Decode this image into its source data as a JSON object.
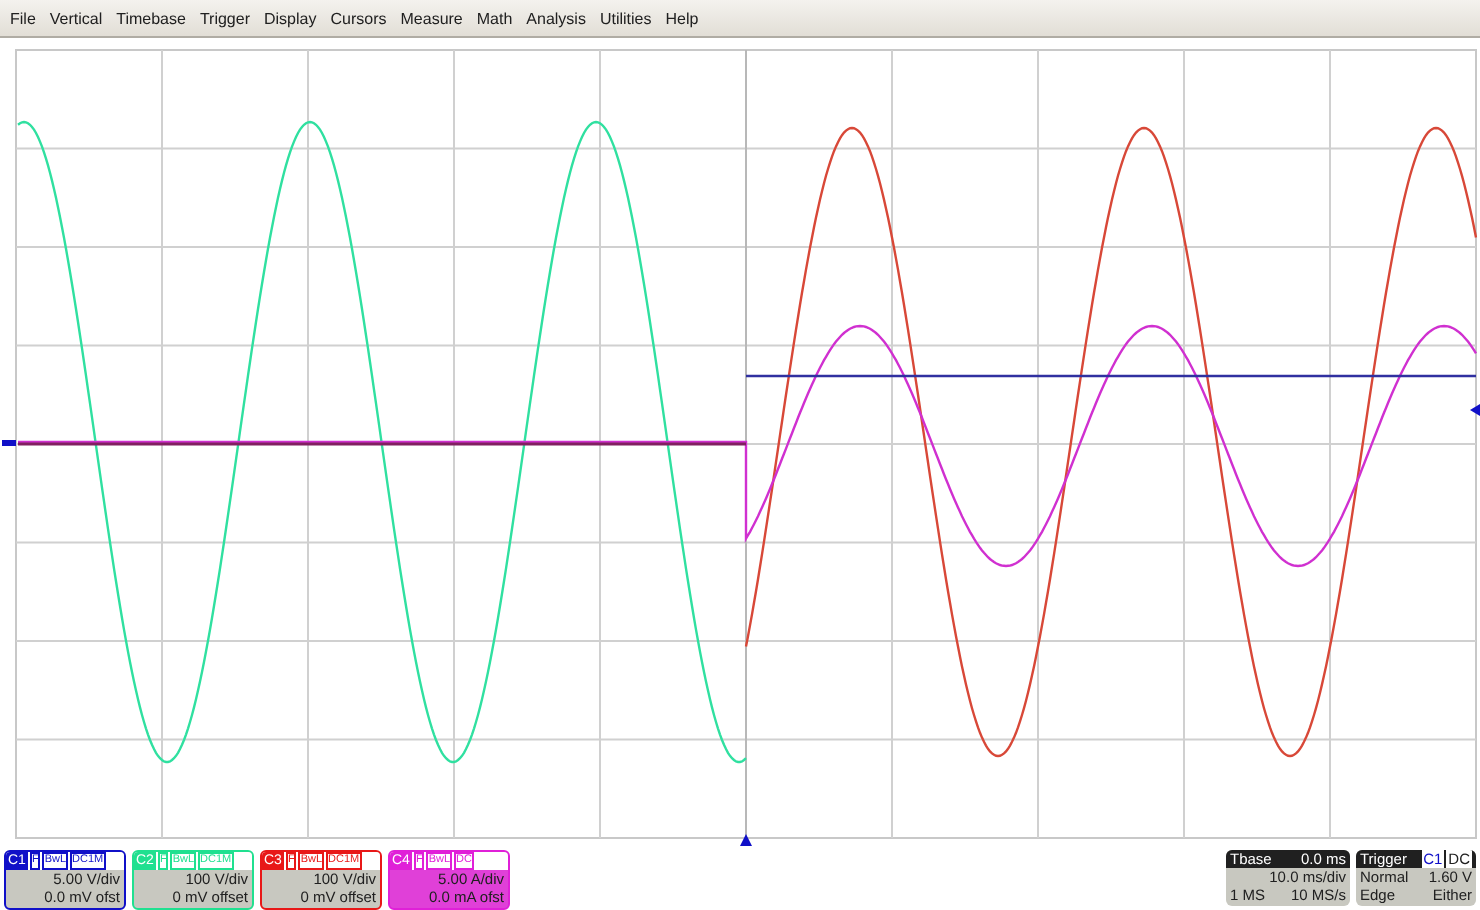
{
  "menu": [
    "File",
    "Vertical",
    "Timebase",
    "Trigger",
    "Display",
    "Cursors",
    "Measure",
    "Math",
    "Analysis",
    "Utilities",
    "Help"
  ],
  "channels": [
    {
      "label": "C1",
      "tags": [
        "F",
        "BwL",
        "DC1M"
      ],
      "scale": "5.00 V/div",
      "offset": "0.0 mV ofst",
      "color": "#1010c8",
      "selected": false
    },
    {
      "label": "C2",
      "tags": [
        "F",
        "BwL",
        "DC1M"
      ],
      "scale": "100 V/div",
      "offset": "0 mV offset",
      "color": "#20e090",
      "selected": false
    },
    {
      "label": "C3",
      "tags": [
        "F",
        "BwL",
        "DC1M"
      ],
      "scale": "100 V/div",
      "offset": "0 mV offset",
      "color": "#e81818",
      "selected": false
    },
    {
      "label": "C4",
      "tags": [
        "F",
        "BwL",
        "DC"
      ],
      "scale": "5.00 A/div",
      "offset": "0.0 mA ofst",
      "color": "#e020d8",
      "selected": true
    }
  ],
  "timebase": {
    "title": "Tbase",
    "delay": "0.0 ms",
    "scale": "10.0 ms/div",
    "points": "1 MS",
    "rate": "10 MS/s"
  },
  "trigger": {
    "title": "Trigger",
    "source": "C1",
    "coupling": "DC",
    "mode": "Normal",
    "level": "1.60 V",
    "type": "Edge",
    "slope": "Either"
  }
}
